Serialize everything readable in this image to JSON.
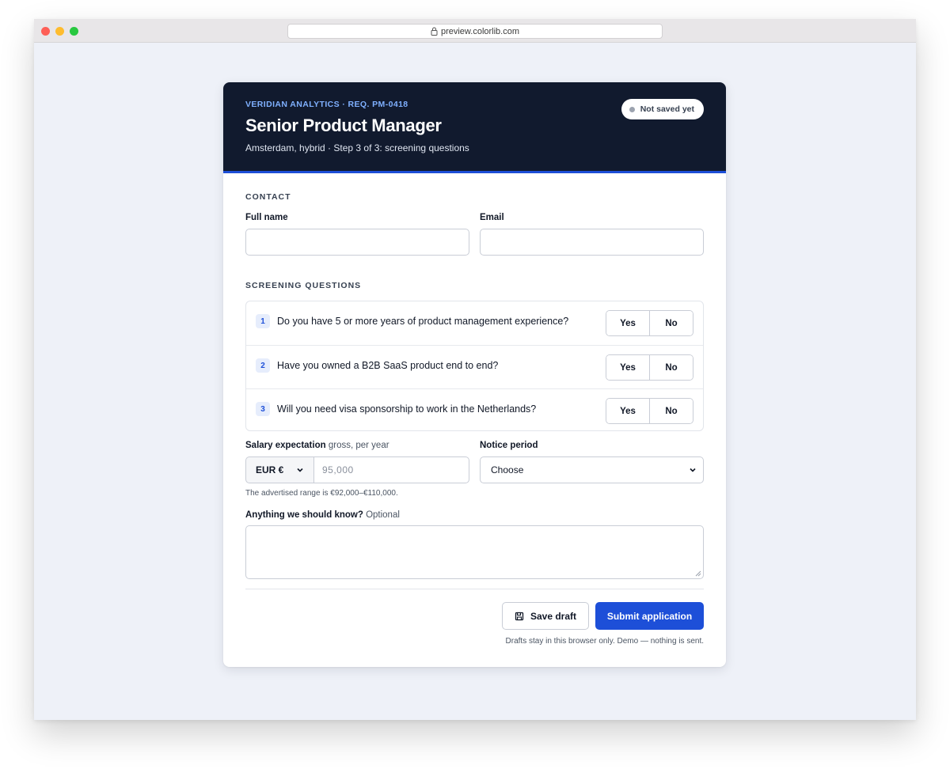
{
  "browser": {
    "url": "preview.colorlib.com"
  },
  "header": {
    "eyebrow": "VERIDIAN ANALYTICS · REQ. PM-0418",
    "title": "Senior Product Manager",
    "subtitle": "Amsterdam, hybrid · Step 3 of 3: screening questions",
    "status": "Not saved yet"
  },
  "contact": {
    "section_label": "CONTACT",
    "full_name_label": "Full name",
    "full_name_value": "",
    "email_label": "Email",
    "email_value": ""
  },
  "screening": {
    "section_label": "SCREENING QUESTIONS",
    "yes_label": "Yes",
    "no_label": "No",
    "questions": [
      {
        "num": "1",
        "text": "Do you have 5 or more years of product management experience?"
      },
      {
        "num": "2",
        "text": "Have you owned a B2B SaaS product end to end?"
      },
      {
        "num": "3",
        "text": "Will you need visa sponsorship to work in the Netherlands?"
      }
    ]
  },
  "salary": {
    "label": "Salary expectation",
    "label_note": "gross, per year",
    "currency": "EUR €",
    "placeholder": "95,000",
    "hint": "The advertised range is €92,000–€110,000."
  },
  "notice": {
    "label": "Notice period",
    "selected": "Choose"
  },
  "notes": {
    "label": "Anything we should know?",
    "label_note": "Optional"
  },
  "actions": {
    "save_draft": "Save draft",
    "submit": "Submit application",
    "footnote": "Drafts stay in this browser only. Demo — nothing is sent."
  },
  "colors": {
    "header_bg": "#111a2e",
    "accent": "#1d4fd8",
    "eyebrow": "#7fb0ff"
  }
}
